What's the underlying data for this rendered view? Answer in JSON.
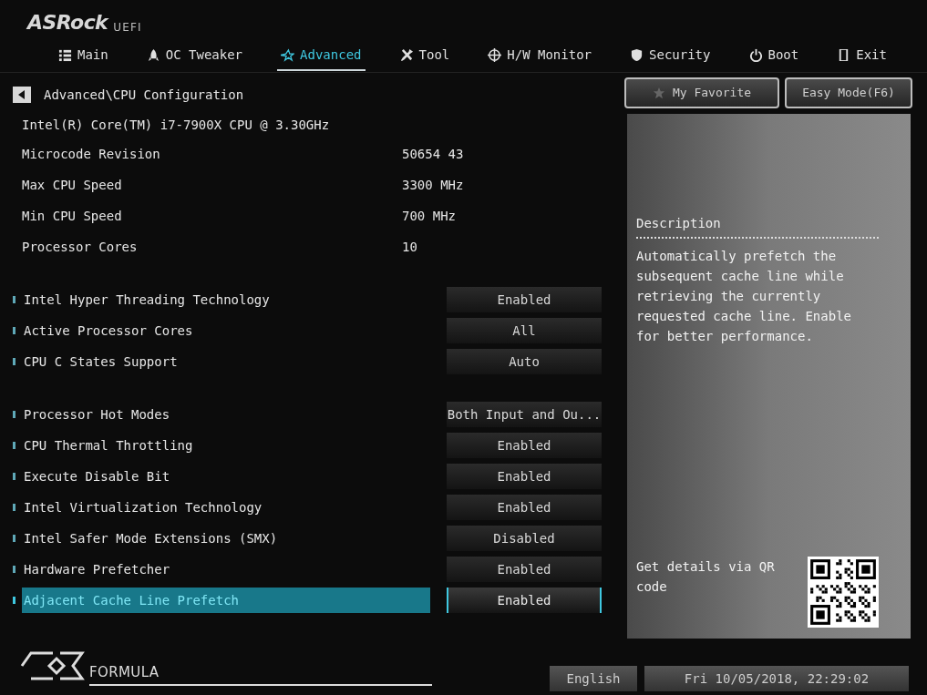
{
  "logo": {
    "brand": "ASRock",
    "suffix": "UEFI"
  },
  "tabs": [
    {
      "label": "Main",
      "selected": false
    },
    {
      "label": "OC Tweaker",
      "selected": false
    },
    {
      "label": "Advanced",
      "selected": true
    },
    {
      "label": "Tool",
      "selected": false
    },
    {
      "label": "H/W Monitor",
      "selected": false
    },
    {
      "label": "Security",
      "selected": false
    },
    {
      "label": "Boot",
      "selected": false
    },
    {
      "label": "Exit",
      "selected": false
    }
  ],
  "breadcrumb": "Advanced\\CPU Configuration",
  "top_buttons": [
    "My Favorite",
    "Easy Mode(F6)"
  ],
  "cpu_name": "Intel(R) Core(TM) i7-7900X CPU @ 3.30GHz",
  "info": [
    {
      "label": "Microcode Revision",
      "value": "50654 43"
    },
    {
      "label": "Max CPU Speed",
      "value": "3300 MHz"
    },
    {
      "label": "Min CPU Speed",
      "value": "700 MHz"
    },
    {
      "label": "Processor Cores",
      "value": "10"
    }
  ],
  "setting_groups": [
    [
      {
        "label": "Intel Hyper Threading Technology",
        "value": "Enabled",
        "selected": false
      },
      {
        "label": "Active Processor Cores",
        "value": "All",
        "selected": false
      },
      {
        "label": "CPU C States Support",
        "value": "Auto",
        "selected": false
      }
    ],
    [
      {
        "label": "Processor Hot Modes",
        "value": "Both Input and Ou...",
        "selected": false
      },
      {
        "label": "CPU Thermal Throttling",
        "value": "Enabled",
        "selected": false
      },
      {
        "label": "Execute Disable Bit",
        "value": "Enabled",
        "selected": false
      },
      {
        "label": "Intel Virtualization Technology",
        "value": "Enabled",
        "selected": false
      },
      {
        "label": "Intel Safer Mode Extensions (SMX)",
        "value": "Disabled",
        "selected": false
      },
      {
        "label": "Hardware Prefetcher",
        "value": "Enabled",
        "selected": false
      },
      {
        "label": "Adjacent Cache Line Prefetch",
        "value": "Enabled",
        "selected": true
      }
    ]
  ],
  "description": {
    "title": "Description",
    "text": "Automatically prefetch the subsequent cache line while retrieving the currently requested cache line. Enable for better performance."
  },
  "qr_note": "Get details via QR code",
  "footer": {
    "brand": "FORMULA",
    "language": "English",
    "datetime": "Fri 10/05/2018, 22:29:02"
  }
}
